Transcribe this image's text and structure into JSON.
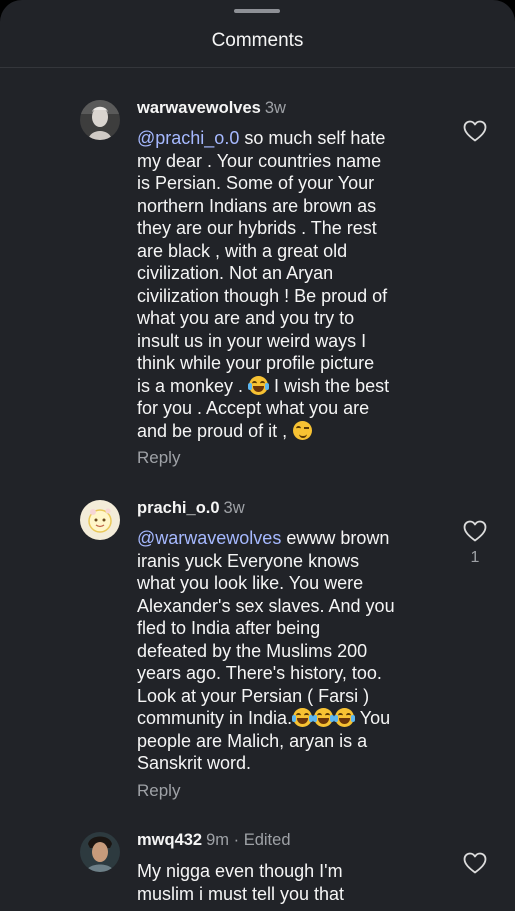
{
  "header": {
    "title": "Comments"
  },
  "comments": [
    {
      "username": "warwavewolves",
      "time": "3w",
      "mention": "@prachi_o.0",
      "lines": [
        " so much self hate",
        "my dear . Your countries name",
        "is Persian. Some of your Your",
        "northern Indians are brown as",
        "they are our hybrids . The rest",
        "are black , with a great old",
        "civilization. Not an Aryan",
        "civilization though ! Be proud of",
        "what you are and you try to",
        "insult us in your weird ways I",
        "think while your profile picture",
        "is a monkey . ",
        " I wish the best",
        "for  you . Accept what you are",
        "and be proud of it , "
      ],
      "reply_label": "Reply",
      "like_count": ""
    },
    {
      "username": "prachi_o.0",
      "time": "3w",
      "mention": "@warwavewolves",
      "lines": [
        " ewww brown",
        "iranis yuck Everyone knows",
        "what you look like. You were",
        "Alexander's sex slaves. And you",
        "fled to India after being",
        "defeated by the Muslims 200",
        "years ago. There's history, too.",
        "Look at your Persian ( Farsi )",
        "community in India.",
        " You",
        "people  are  Malich,  aryan is a",
        "Sanskrit word."
      ],
      "reply_label": "Reply",
      "like_count": "1"
    },
    {
      "username": "mwq432",
      "time": "9m · Edited",
      "lines": [
        "My nigga even though I'm",
        "muslim i must tell you that"
      ],
      "like_count": ""
    }
  ],
  "icons": {
    "heart": "heart-outline-icon",
    "emoji_laugh": "tears-of-joy-emoji",
    "emoji_wink": "winking-face-emoji"
  },
  "colors": {
    "background": "#212328",
    "mention": "#a6b9ff",
    "secondary_text": "#9ea1a6"
  }
}
